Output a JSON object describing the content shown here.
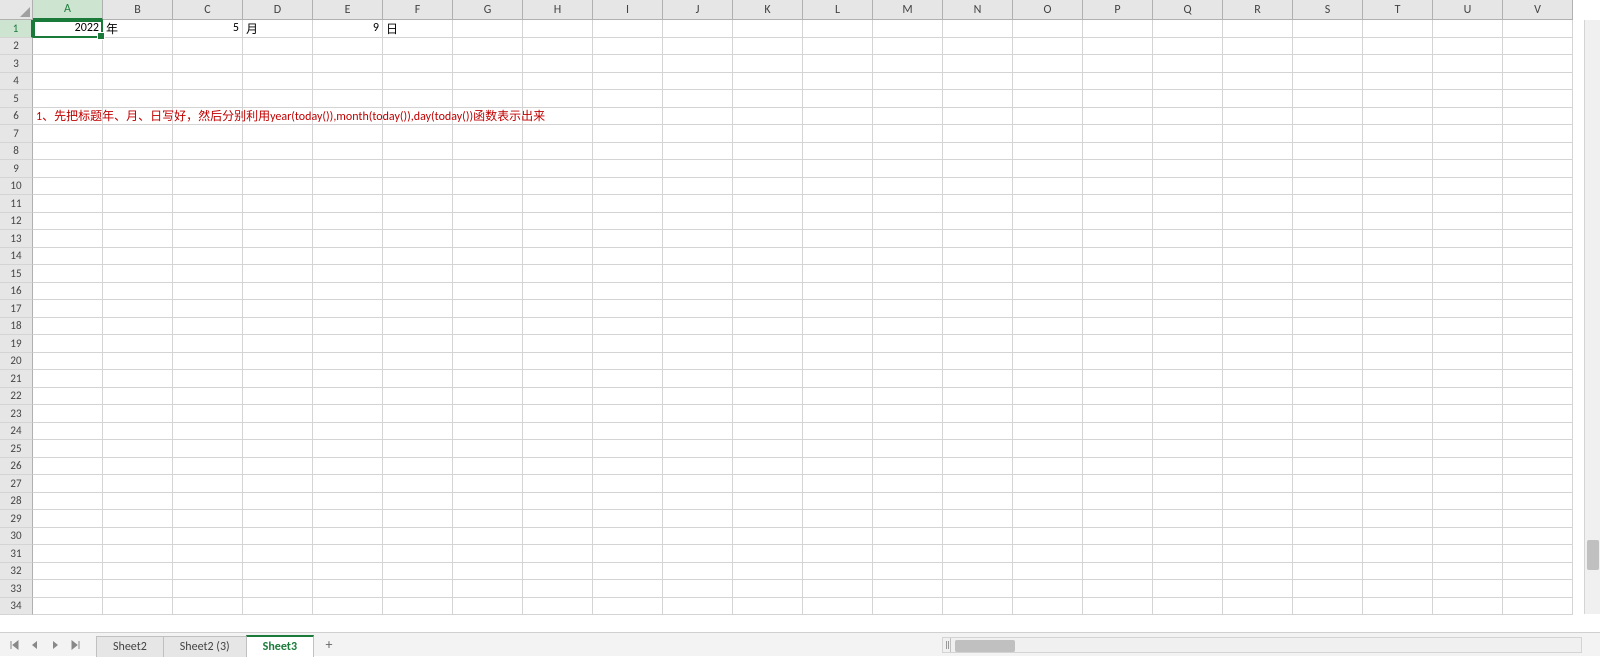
{
  "columns": [
    "A",
    "B",
    "C",
    "D",
    "E",
    "F",
    "G",
    "H",
    "I",
    "J",
    "K",
    "L",
    "M",
    "N",
    "O",
    "P",
    "Q",
    "R",
    "S",
    "T",
    "U",
    "V"
  ],
  "row_count": 34,
  "selected_cell": {
    "row": 1,
    "col": "A"
  },
  "cells": {
    "A1": {
      "value": "2022",
      "align": "right"
    },
    "B1": {
      "value": "年",
      "align": "left"
    },
    "C1": {
      "value": "5",
      "align": "right"
    },
    "D1": {
      "value": "月",
      "align": "left"
    },
    "E1": {
      "value": "9",
      "align": "right"
    },
    "F1": {
      "value": "日",
      "align": "left"
    },
    "A6": {
      "value": "1、先把标题年、月、日写好，然后分别利用year(today()),month(today()),day(today())函数表示出来",
      "align": "left",
      "color": "red",
      "overflow": true
    }
  },
  "tabs": [
    {
      "name": "Sheet2",
      "active": false
    },
    {
      "name": "Sheet2 (3)",
      "active": false
    },
    {
      "name": "Sheet3",
      "active": true
    }
  ],
  "nav_buttons": {
    "first": "⏮",
    "prev": "◀",
    "next": "▶",
    "last": "⏭"
  },
  "add_tab": "+"
}
